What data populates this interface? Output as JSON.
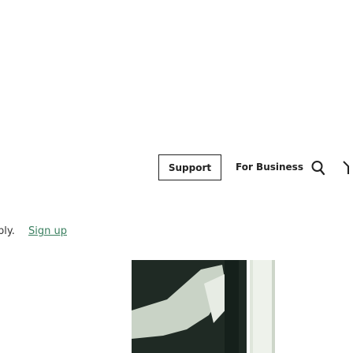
{
  "nav": {
    "support_label": "Support",
    "business_label": "For Business"
  },
  "icons": {
    "search": "search-icon",
    "extra": "partial-icon"
  },
  "footer": {
    "reply_text": "ply.",
    "signup_label": "Sign up"
  },
  "colors": {
    "text": "#222222",
    "signup_link": "#3a7f5f",
    "art_dark": "#1f2a24",
    "art_sage": "#c9d3c6",
    "art_panel": "#dfe6db"
  }
}
